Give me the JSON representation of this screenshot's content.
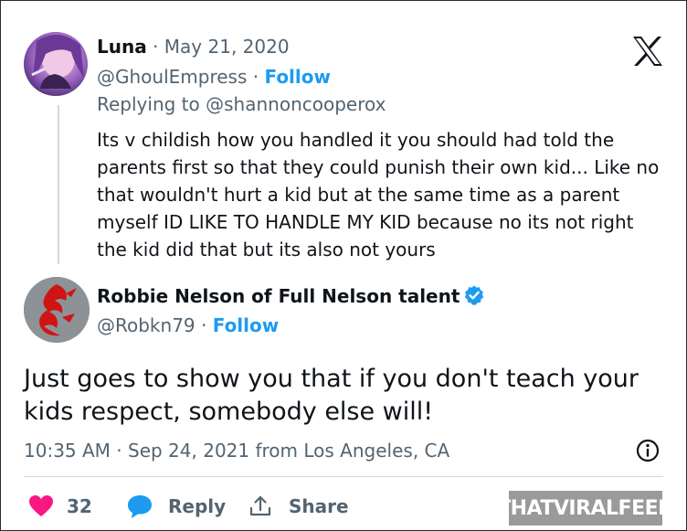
{
  "parent_tweet": {
    "author_name": "Luna",
    "date": "May 21, 2020",
    "handle": "@GhoulEmpress",
    "follow_label": "Follow",
    "replying_to_prefix": "Replying to",
    "replying_to_handle": "@shannoncooperox",
    "text": "Its v childish how you handled it you should had told the parents first so that they could punish their own kid... Like no that wouldn't hurt a kid but at the same time as a parent myself ID LIKE TO HANDLE MY KID because no its not right the kid did that but its also not yours"
  },
  "main_tweet": {
    "author_name": "Robbie Nelson of Full Nelson talent",
    "handle": "@Robkn79",
    "follow_label": "Follow",
    "text": "Just goes to show you that if you don't teach your kids respect, somebody else will!",
    "timestamp": "10:35 AM · Sep 24, 2021 from Los Angeles, CA"
  },
  "actions": {
    "like_count": "32",
    "reply_label": "Reply",
    "share_label": "Share"
  },
  "watermark": "THATVIRALFEED",
  "icons": [
    "x-logo-icon",
    "verified-badge-icon",
    "info-icon",
    "heart-icon",
    "reply-bubble-icon",
    "share-icon"
  ],
  "colors": {
    "accent": "#1d9bf0",
    "like": "#f91880",
    "text": "#0f1419",
    "secondary": "#536471"
  }
}
